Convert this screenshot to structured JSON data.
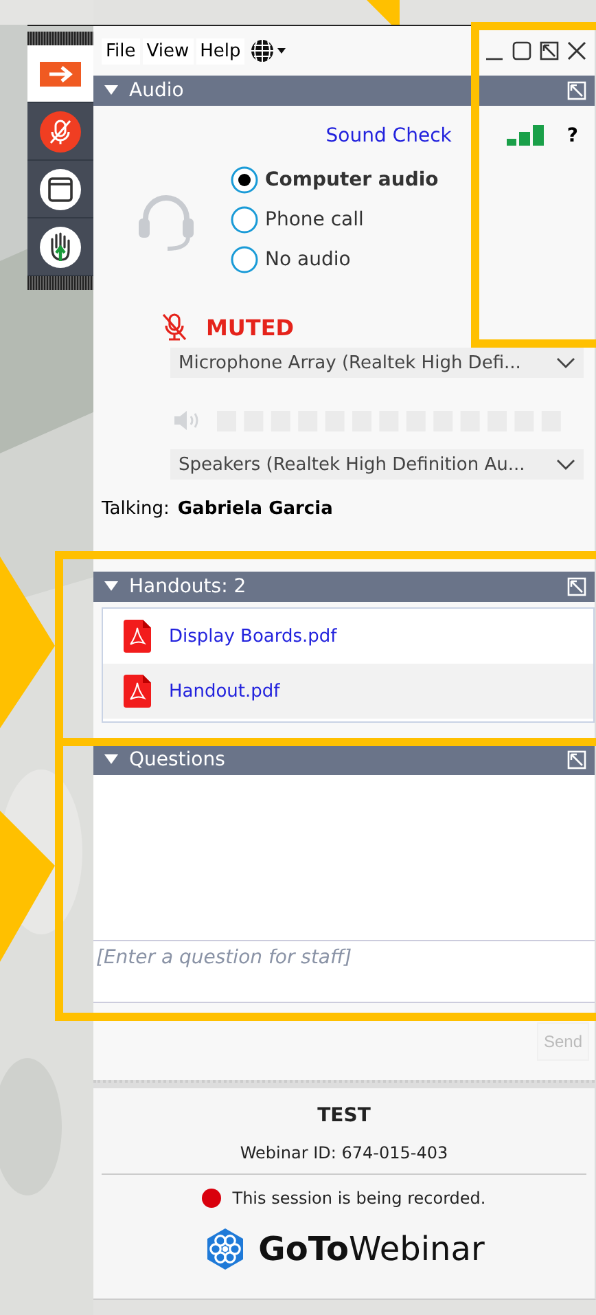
{
  "menu": [
    "File",
    "View",
    "Help"
  ],
  "toolbar": [
    {
      "kind": "arrow",
      "selected": true
    },
    {
      "kind": "mute",
      "selected": false
    },
    {
      "kind": "window",
      "selected": false
    },
    {
      "kind": "hand",
      "selected": false
    }
  ],
  "audio": {
    "title": "Audio",
    "sound_check": "Sound Check",
    "help": "?",
    "options": [
      {
        "label": "Computer audio",
        "selected": true
      },
      {
        "label": "Phone call",
        "selected": false
      },
      {
        "label": "No audio",
        "selected": false
      }
    ],
    "muted": true,
    "muted_label": "MUTED",
    "microphone": "Microphone Array (Realtek High Defi...",
    "speakers": "Speakers (Realtek High Definition Au...",
    "talking_label": "Talking:",
    "talking_name": "Gabriela Garcia"
  },
  "handouts": {
    "title": "Handouts: 2",
    "files": [
      "Display Boards.pdf",
      "Handout.pdf"
    ]
  },
  "questions": {
    "title": "Questions",
    "placeholder": "[Enter a question for staff]",
    "send": "Send"
  },
  "footer": {
    "title": "TEST",
    "webinar_id": "Webinar ID: 674-015-403",
    "recording": "This session is being recorded.",
    "logo_bold": "GoTo",
    "logo_light": "Webinar"
  }
}
